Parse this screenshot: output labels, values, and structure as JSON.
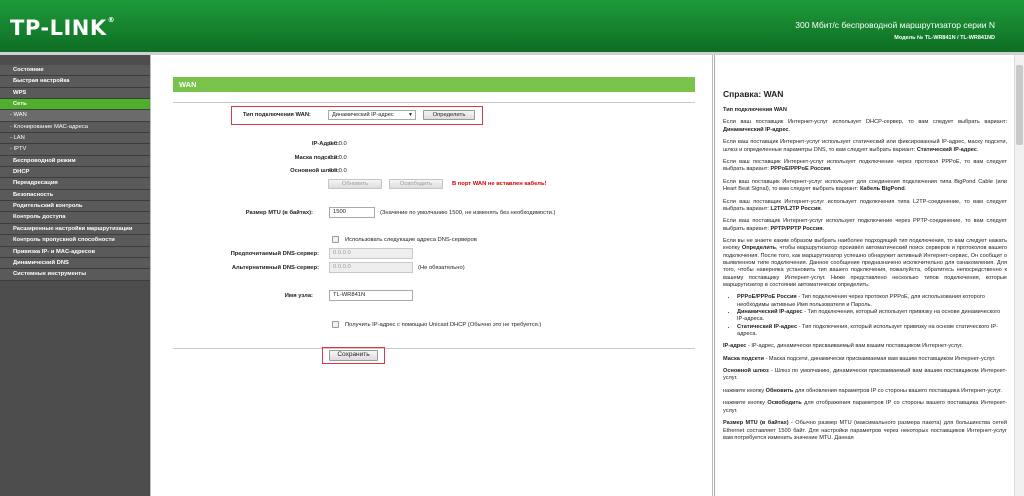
{
  "header": {
    "logo": "TP-LINK",
    "logo_reg": "®",
    "title": "300 Мбит/с беспроводной маршрутизатор серии N",
    "model": "Модель № TL-WR841N / TL-WR841ND"
  },
  "sidebar": {
    "items": [
      {
        "label": "Состояние"
      },
      {
        "label": "Быстрая настройка"
      },
      {
        "label": "WPS"
      },
      {
        "label": "Сеть"
      },
      {
        "label": "- WAN"
      },
      {
        "label": "- Клонирование MAC-адреса"
      },
      {
        "label": "- LAN"
      },
      {
        "label": "- IPTV"
      },
      {
        "label": "Беспроводной режим"
      },
      {
        "label": "DHCP"
      },
      {
        "label": "Переадресация"
      },
      {
        "label": "Безопасность"
      },
      {
        "label": "Родительский контроль"
      },
      {
        "label": "Контроль доступа"
      },
      {
        "label": "Расширенные настройки маршрутизации"
      },
      {
        "label": "Контроль пропускной способности"
      },
      {
        "label": "Привязка IP- и MAC-адресов"
      },
      {
        "label": "Динамический DNS"
      },
      {
        "label": "Системные инструменты"
      }
    ]
  },
  "main": {
    "section_title": "WAN",
    "wan_type_label": "Тип подключения WAN:",
    "wan_type_value": "Динамический IP-адрес",
    "detect_button": "Определить",
    "ip_label": "IP-Адрес:",
    "ip_value": "0.0.0.0",
    "mask_label": "Маска подсети:",
    "mask_value": "0.0.0.0",
    "gateway_label": "Основной шлюз:",
    "gateway_value": "0.0.0.0",
    "renew_button": "Обновить",
    "release_button": "Освободить",
    "warning": "В порт WAN не вставлен кабель!",
    "mtu_label": "Размер MTU (в байтах):",
    "mtu_value": "1500",
    "mtu_note": "(Значение по умолчанию 1500, не изменять без необходимости.)",
    "use_dns_label": "Использовать следующие адреса DNS-серверов",
    "primary_dns_label": "Предпочитаемый DNS-сервер:",
    "primary_dns_value": "0.0.0.0",
    "alt_dns_label": "Альтернативный DNS-сервер:",
    "alt_dns_value": "0.0.0.0",
    "alt_dns_note": "(Не обязательно)",
    "host_label": "Имя узла:",
    "host_value": "TL-WR841N",
    "unicast_label": "Получить IP-адрес с помощью Unicast DHCP (Обычно это не требуется.)",
    "save_button": "Сохранить"
  },
  "help": {
    "title": "Справка: WAN",
    "heading": "Тип подключения WAN",
    "p1": {
      "pre": "Если ваш поставщик Интернет-услуг использует DHCP-сервер, то вам следует выбрать вариант: ",
      "bold": "Динамический IP-адрес",
      "post": "."
    },
    "p2": {
      "pre": "Если ваш поставщик Интернет-услуг использует статический или фиксированный IP-адрес, маску подсети, шлюз и определенные параметры DNS, то вам следует выбрать вариант: ",
      "bold": "Статический IP-адрес",
      "post": "."
    },
    "p3": {
      "pre": "Если ваш поставщик Интернет-услуг использует подключение через протокол PPPoE, то вам следует выбрать вариант: ",
      "bold": "PPPoE/PPPoE Россия",
      "post": "."
    },
    "p4": {
      "pre": "Если ваш поставщик Интернет-услуг использует для соединения подключения типа BigPond Cable (или Heart Beat Signal), то вам следует выбрать вариант: ",
      "bold": "Кабель BigPond",
      "post": "."
    },
    "p5": {
      "pre": "Если ваш поставщик Интернет-услуг использует подключения типа L2TP-соединение, то вам следует выбрать вариант: ",
      "bold": "L2TP/L2TP Россия",
      "post": "."
    },
    "p6": {
      "pre": "Если ваш поставщик Интернет-услуг использует подключение через PPTP-соединение, то вам следует выбрать вариант: ",
      "bold": "PPTP/PPTP Россия",
      "post": "."
    },
    "p7": {
      "pre": "Если вы не знаете каким образом выбрать наиболее подходящий тип подключения, то вам следует нажать кнопку ",
      "bold": "Определить",
      "post": ", чтобы маршрутизатор произвёл автоматический поиск серверов и протоколов вашего подключения. После того, как маршрутизатор успешно обнаружит активный Интернет-сервис, Он сообщит о выявленном типе подключения. Данное сообщение предназначено исключительно для ознакомления. Для того, чтобы наверняка установить тип вашего подключения, пожалуйста, обратитесь непосредственно к вашему поставщику Интернет-услуг. Ниже представлено несколько типов подключения, которые маршрутизатор в состоянии автоматически определить:"
    },
    "li1": {
      "bold": "PPPoE/PPPoE Россия",
      "post": " - Тип подключения через протокол PPPoE, для использования которого необходимы активные Имя пользователя и Пароль."
    },
    "li2": {
      "bold": "Динамический IP-адрес",
      "post": " - Тип подключения, который использует привязку на основе динамического IP-адреса."
    },
    "li3": {
      "bold": "Статический IP-адрес",
      "post": " - Тип подключения, который использует привязку на основе статического IP-адреса."
    },
    "p8": {
      "bold": "IP-адрес",
      "post": " - IP-адрес, динамически присваиваемый вам вашим поставщиком Интернет-услуг."
    },
    "p9": {
      "bold": "Маска подсети",
      "post": " - Маска подсети, динамически присваиваемая вам вашим поставщиком Интернет-услуг."
    },
    "p10": {
      "bold": "Основной шлюз",
      "post": " - Шлюз по умолчанию, динамически присваиваемый вам вашим поставщиком Интернет-услуг."
    },
    "p11": {
      "pre": "нажмите кнопку ",
      "bold": "Обновить",
      "post": " для обновления параметров IP со стороны вашего поставщика Интернет-услуг."
    },
    "p12": {
      "pre": "нажмите кнопку ",
      "bold": "Освободить",
      "post": " для отображения параметров IP со стороны вашего поставщика Интернет-услуг."
    },
    "p13": {
      "bold": "Размер MTU (в байтах)",
      "post": " - Обычно размер MTU (максимального размера пакета) для большинства сетей Ethernet составляет 1500 байт. Для настройки параметров через некоторых поставщиков Интернет-услуг вам потребуется изменить значение MTU. Данная"
    }
  }
}
